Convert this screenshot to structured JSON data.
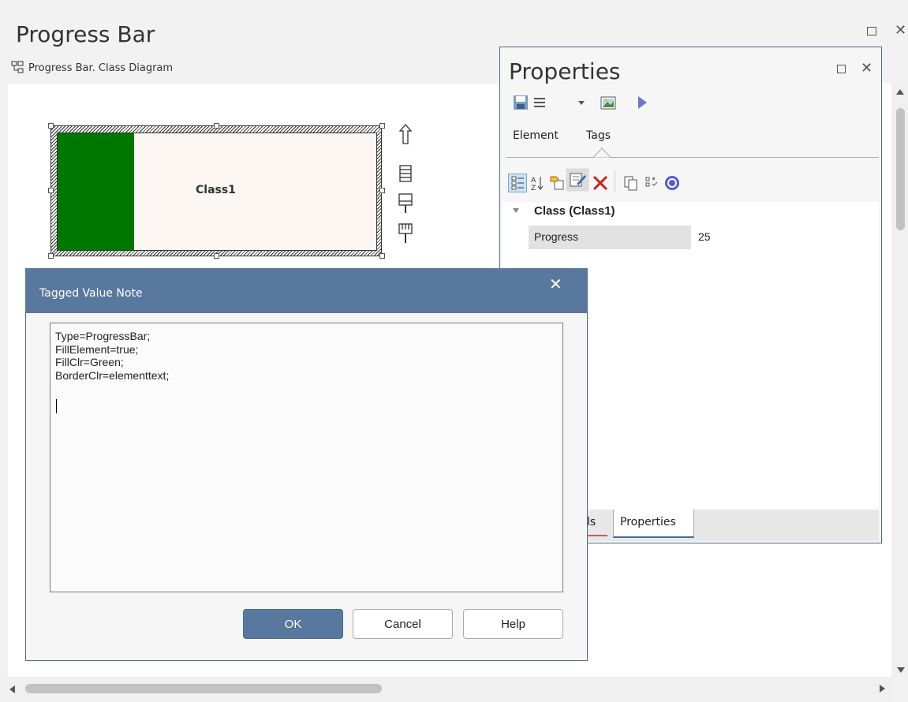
{
  "window": {
    "title": "Progress Bar",
    "breadcrumb": "Progress Bar.  Class Diagram",
    "close_glyph": "✕"
  },
  "diagram": {
    "class_name": "Class1",
    "progress_value": 25,
    "fill_color": "#007800"
  },
  "properties": {
    "title": "Properties",
    "close_glyph": "✕",
    "tabs": [
      {
        "label": "Element"
      },
      {
        "label": "Tags"
      }
    ],
    "group_label": "Class (Class1)",
    "rows": [
      {
        "name": "Progress",
        "value": "25"
      }
    ],
    "bottom_tabs": [
      {
        "label": "ls"
      },
      {
        "label": "Properties"
      }
    ],
    "icons": [
      "save-icon",
      "menu-icon",
      "image-icon",
      "play-icon",
      "categorized-icon",
      "sort-az-icon",
      "new-tag-icon",
      "edit-tag-icon",
      "delete-icon",
      "copy-icon",
      "checklist-icon",
      "help-icon"
    ]
  },
  "dialog": {
    "title": "Tagged Value Note",
    "close_glyph": "✕",
    "note_lines": [
      "Type=ProgressBar;",
      "FillElement=true;",
      "FillClr=Green;",
      "BorderClr=elementtext;"
    ],
    "ok_label": "OK",
    "cancel_label": "Cancel",
    "help_label": "Help"
  },
  "colors": {
    "accent": "#58789e",
    "progress_fill": "#007800",
    "delete_red": "#d02020"
  }
}
